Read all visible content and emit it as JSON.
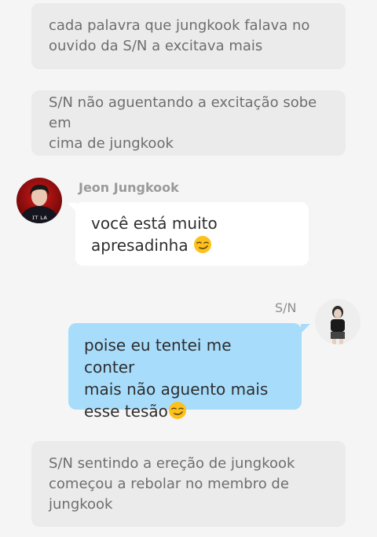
{
  "narration_1": {
    "line1": "cada palavra que jungkook falava no",
    "line2": "ouvido da S/N a excitava mais"
  },
  "narration_2": {
    "line1": "S/N não aguentando a excitação sobe em",
    "line2": "cima de jungkook"
  },
  "message_1": {
    "sender": "Jeon Jungkook",
    "line1": "você está muito",
    "line2": "apresadinha",
    "emoji": "smirk-emoji"
  },
  "message_2": {
    "sender": "S/N",
    "line1": "poise eu tentei me conter",
    "line2": "mais não aguento mais",
    "line3": "esse tesão",
    "emoji": "smirk-emoji"
  },
  "narration_3": {
    "line1": "S/N sentindo a ereção de jungkook",
    "line2": "começou a rebolar no membro de",
    "line3": "jungkook"
  },
  "colors": {
    "background": "#f5f5f5",
    "narration_bg": "#ebebeb",
    "bubble_white": "#ffffff",
    "bubble_blue": "#a7dcfb"
  }
}
